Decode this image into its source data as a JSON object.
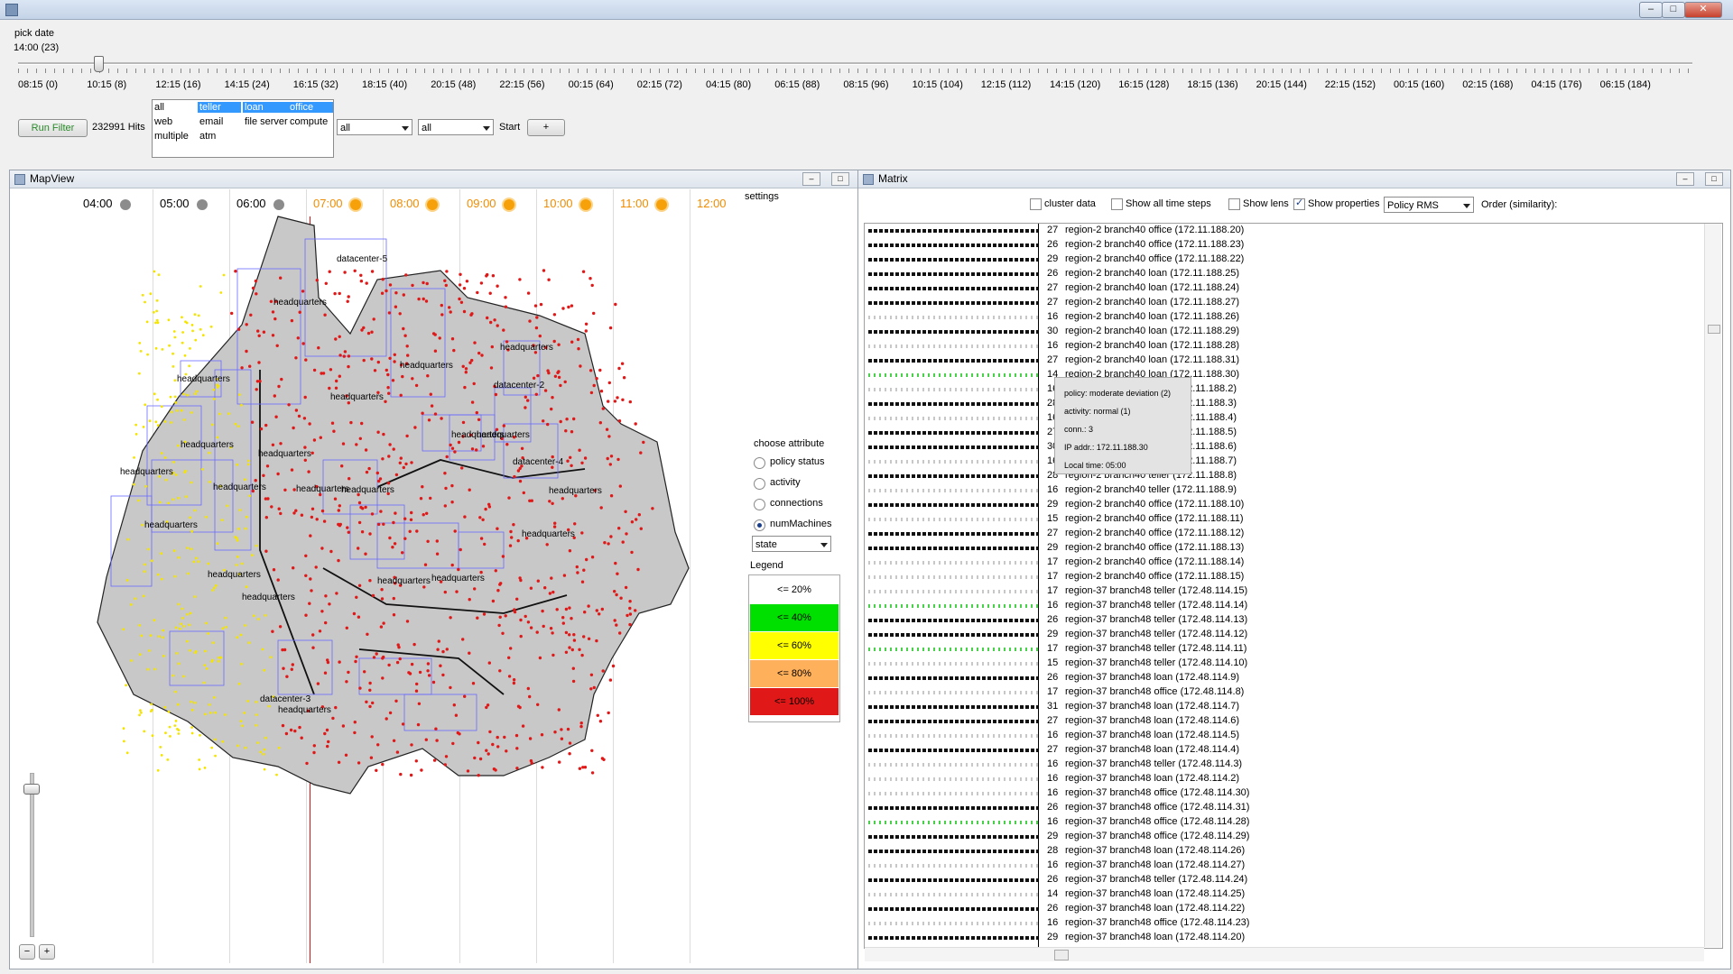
{
  "window": {
    "title": "",
    "buttons": [
      "–",
      "□",
      "✕"
    ]
  },
  "date_picker": {
    "label": "pick date",
    "current": "14:00 (23)",
    "ticks": [
      "08:15 (0)",
      "10:15 (8)",
      "12:15 (16)",
      "14:15 (24)",
      "16:15 (32)",
      "18:15 (40)",
      "20:15 (48)",
      "22:15 (56)",
      "00:15 (64)",
      "02:15 (72)",
      "04:15 (80)",
      "06:15 (88)",
      "08:15 (96)",
      "10:15 (104)",
      "12:15 (112)",
      "14:15 (120)",
      "16:15 (128)",
      "18:15 (136)",
      "20:15 (144)",
      "22:15 (152)",
      "00:15 (160)",
      "02:15 (168)",
      "04:15 (176)",
      "06:15 (184)"
    ],
    "position_step": 23,
    "max_step": 184
  },
  "filter": {
    "run_button": "Run Filter",
    "hits": "232991 Hits",
    "list_items": [
      {
        "text": "all",
        "col": 0,
        "row": 0,
        "selected": false
      },
      {
        "text": "web",
        "col": 0,
        "row": 1,
        "selected": false
      },
      {
        "text": "multiple",
        "col": 0,
        "row": 2,
        "selected": false
      },
      {
        "text": "teller",
        "col": 1,
        "row": 0,
        "selected": true
      },
      {
        "text": "email",
        "col": 1,
        "row": 1,
        "selected": false
      },
      {
        "text": "atm",
        "col": 1,
        "row": 2,
        "selected": false
      },
      {
        "text": "loan",
        "col": 2,
        "row": 0,
        "selected": true
      },
      {
        "text": "file server",
        "col": 2,
        "row": 1,
        "selected": false
      },
      {
        "text": "office",
        "col": 3,
        "row": 0,
        "selected": true
      },
      {
        "text": "compute",
        "col": 3,
        "row": 1,
        "selected": false
      }
    ],
    "combo1": "all",
    "combo2": "all",
    "start_label": "Start",
    "add_button": "+"
  },
  "mapview": {
    "title": "MapView",
    "settings_label": "settings",
    "hours": [
      {
        "t": "04:00",
        "icon": "moon"
      },
      {
        "t": "05:00",
        "icon": "moon"
      },
      {
        "t": "06:00",
        "icon": "moon"
      },
      {
        "t": "07:00",
        "icon": "sun"
      },
      {
        "t": "08:00",
        "icon": "sun"
      },
      {
        "t": "09:00",
        "icon": "sun"
      },
      {
        "t": "10:00",
        "icon": "sun"
      },
      {
        "t": "11:00",
        "icon": "sun"
      },
      {
        "t": "12:00",
        "icon": "sun"
      }
    ],
    "choose_attribute": "choose attribute",
    "attributes": [
      "policy status",
      "activity",
      "connections",
      "numMachines"
    ],
    "selected_attribute": "numMachines",
    "state_combo": "state",
    "legend_title": "Legend",
    "legend": [
      {
        "label": "<= 20%",
        "color": "#ffffff"
      },
      {
        "label": "<= 40%",
        "color": "#00e000"
      },
      {
        "label": "<= 60%",
        "color": "#ffff00"
      },
      {
        "label": "<= 80%",
        "color": "#ffb05a"
      },
      {
        "label": "<= 100%",
        "color": "#e01818"
      }
    ],
    "map_labels": [
      "datacenter-5",
      "headquarters",
      "headquarters",
      "headquarters",
      "headquarters",
      "headquarters",
      "headquarters",
      "headquarters",
      "headquarters",
      "datacenter-2",
      "headquarters",
      "headquarters",
      "datacenter-4",
      "headquarters",
      "headquarters",
      "headquarters",
      "headquarters",
      "headquarters",
      "headquarters",
      "headquarters",
      "headquarters",
      "headquarters",
      "datacenter-3",
      "headquarters",
      "headquarters"
    ],
    "zoom_minus": "−",
    "zoom_plus": "+"
  },
  "matrix": {
    "title": "Matrix",
    "options": [
      {
        "label": "cluster data",
        "checked": false
      },
      {
        "label": "Show all time steps",
        "checked": false
      },
      {
        "label": "Show lens",
        "checked": false
      },
      {
        "label": "Show properties",
        "checked": true
      }
    ],
    "policy_combo": "Policy RMS",
    "order_label": "Order (similarity):",
    "rows": [
      {
        "n": "27",
        "text": "region-2  branch40  office (172.11.188.20)",
        "pattern": "black"
      },
      {
        "n": "26",
        "text": "region-2  branch40  office (172.11.188.23)",
        "pattern": "black"
      },
      {
        "n": "29",
        "text": "region-2  branch40  office (172.11.188.22)",
        "pattern": "black"
      },
      {
        "n": "26",
        "text": "region-2  branch40  loan (172.11.188.25)",
        "pattern": "black"
      },
      {
        "n": "27",
        "text": "region-2  branch40  loan (172.11.188.24)",
        "pattern": "black"
      },
      {
        "n": "27",
        "text": "region-2  branch40  loan (172.11.188.27)",
        "pattern": "black"
      },
      {
        "n": "16",
        "text": "region-2  branch40  loan (172.11.188.26)",
        "pattern": "light"
      },
      {
        "n": "30",
        "text": "region-2  branch40  loan (172.11.188.29)",
        "pattern": "black"
      },
      {
        "n": "16",
        "text": "region-2  branch40  loan (172.11.188.28)",
        "pattern": "light"
      },
      {
        "n": "27",
        "text": "region-2  branch40  loan (172.11.188.31)",
        "pattern": "black"
      },
      {
        "n": "14",
        "text": "region-2  branch40  loan (172.11.188.30)",
        "pattern": "green"
      },
      {
        "n": "16",
        "text": "region-2  branch40  teller (172.11.188.2)",
        "pattern": "light"
      },
      {
        "n": "28",
        "text": "region-2  branch40  teller (172.11.188.3)",
        "pattern": "black"
      },
      {
        "n": "16",
        "text": "region-2  branch40  teller (172.11.188.4)",
        "pattern": "light"
      },
      {
        "n": "27",
        "text": "region-2  branch40  teller (172.11.188.5)",
        "pattern": "black"
      },
      {
        "n": "30",
        "text": "region-2  branch40  teller (172.11.188.6)",
        "pattern": "black"
      },
      {
        "n": "16",
        "text": "region-2  branch40  teller (172.11.188.7)",
        "pattern": "light"
      },
      {
        "n": "28",
        "text": "region-2  branch40  teller (172.11.188.8)",
        "pattern": "black"
      },
      {
        "n": "16",
        "text": "region-2  branch40  teller (172.11.188.9)",
        "pattern": "light"
      },
      {
        "n": "29",
        "text": "region-2  branch40  office (172.11.188.10)",
        "pattern": "black"
      },
      {
        "n": "15",
        "text": "region-2  branch40  office (172.11.188.11)",
        "pattern": "light"
      },
      {
        "n": "27",
        "text": "region-2  branch40  office (172.11.188.12)",
        "pattern": "black"
      },
      {
        "n": "29",
        "text": "region-2  branch40  office (172.11.188.13)",
        "pattern": "black"
      },
      {
        "n": "17",
        "text": "region-2  branch40  office (172.11.188.14)",
        "pattern": "mixed"
      },
      {
        "n": "17",
        "text": "region-2  branch40  office (172.11.188.15)",
        "pattern": "light"
      },
      {
        "n": "17",
        "text": "region-37  branch48  teller (172.48.114.15)",
        "pattern": "light"
      },
      {
        "n": "16",
        "text": "region-37  branch48  teller (172.48.114.14)",
        "pattern": "green"
      },
      {
        "n": "26",
        "text": "region-37  branch48  teller (172.48.114.13)",
        "pattern": "black"
      },
      {
        "n": "29",
        "text": "region-37  branch48  teller (172.48.114.12)",
        "pattern": "black"
      },
      {
        "n": "17",
        "text": "region-37  branch48  teller (172.48.114.11)",
        "pattern": "green"
      },
      {
        "n": "15",
        "text": "region-37  branch48  teller (172.48.114.10)",
        "pattern": "light"
      },
      {
        "n": "26",
        "text": "region-37  branch48  loan (172.48.114.9)",
        "pattern": "black"
      },
      {
        "n": "17",
        "text": "region-37  branch48  office (172.48.114.8)",
        "pattern": "mixed"
      },
      {
        "n": "31",
        "text": "region-37  branch48  loan (172.48.114.7)",
        "pattern": "black"
      },
      {
        "n": "27",
        "text": "region-37  branch48  loan (172.48.114.6)",
        "pattern": "black"
      },
      {
        "n": "16",
        "text": "region-37  branch48  loan (172.48.114.5)",
        "pattern": "light"
      },
      {
        "n": "27",
        "text": "region-37  branch48  loan (172.48.114.4)",
        "pattern": "black"
      },
      {
        "n": "16",
        "text": "region-37  branch48  teller (172.48.114.3)",
        "pattern": "light"
      },
      {
        "n": "16",
        "text": "region-37  branch48  loan (172.48.114.2)",
        "pattern": "light"
      },
      {
        "n": "16",
        "text": "region-37  branch48  office (172.48.114.30)",
        "pattern": "light"
      },
      {
        "n": "26",
        "text": "region-37  branch48  office (172.48.114.31)",
        "pattern": "black"
      },
      {
        "n": "16",
        "text": "region-37  branch48  office (172.48.114.28)",
        "pattern": "green"
      },
      {
        "n": "29",
        "text": "region-37  branch48  office (172.48.114.29)",
        "pattern": "black"
      },
      {
        "n": "28",
        "text": "region-37  branch48  loan (172.48.114.26)",
        "pattern": "black"
      },
      {
        "n": "16",
        "text": "region-37  branch48  loan (172.48.114.27)",
        "pattern": "light"
      },
      {
        "n": "26",
        "text": "region-37  branch48  teller (172.48.114.24)",
        "pattern": "black"
      },
      {
        "n": "14",
        "text": "region-37  branch48  loan (172.48.114.25)",
        "pattern": "light"
      },
      {
        "n": "26",
        "text": "region-37  branch48  loan (172.48.114.22)",
        "pattern": "black"
      },
      {
        "n": "16",
        "text": "region-37  branch48  office (172.48.114.23)",
        "pattern": "light"
      },
      {
        "n": "29",
        "text": "region-37  branch48  loan (172.48.114.20)",
        "pattern": "black"
      }
    ],
    "tooltip": {
      "policy": "policy: moderate deviation (2)",
      "activity": "activity: normal (1)",
      "conn": "conn.: 3",
      "ip": "IP addr.: 172.11.188.30",
      "local_time": "Local time: 05:00"
    }
  }
}
